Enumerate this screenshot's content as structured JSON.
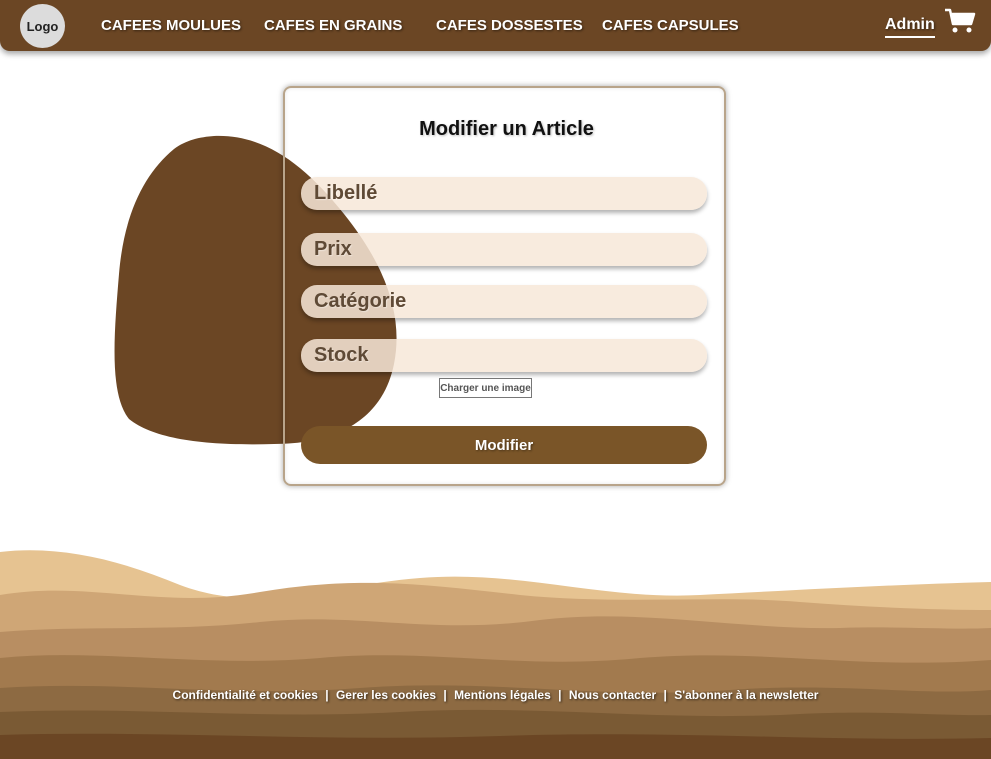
{
  "nav": {
    "logo": "Logo",
    "links": [
      "CAFEES MOULUES",
      "CAFES EN GRAINS",
      "CAFES DOSSESTES",
      "CAFES CAPSULES"
    ],
    "admin": "Admin",
    "cart_icon": "cart-icon"
  },
  "form": {
    "title": "Modifier un Article",
    "fields": [
      {
        "placeholder": "Libellé",
        "value": ""
      },
      {
        "placeholder": "Prix",
        "value": ""
      },
      {
        "placeholder": "Catégorie",
        "value": ""
      },
      {
        "placeholder": "Stock",
        "value": ""
      }
    ],
    "upload_label": "Charger une image",
    "submit_label": "Modifier"
  },
  "footer": {
    "links": [
      "Confidentialité et cookies",
      "Gerer les cookies",
      "Mentions légales",
      "Nous contacter",
      "S'abonner à la newsletter"
    ],
    "separator": "|"
  },
  "colors": {
    "nav_bg": "#6b4624",
    "blob": "#6b4624",
    "field_bg": "#f7e8d8",
    "button": "#7a5528"
  }
}
